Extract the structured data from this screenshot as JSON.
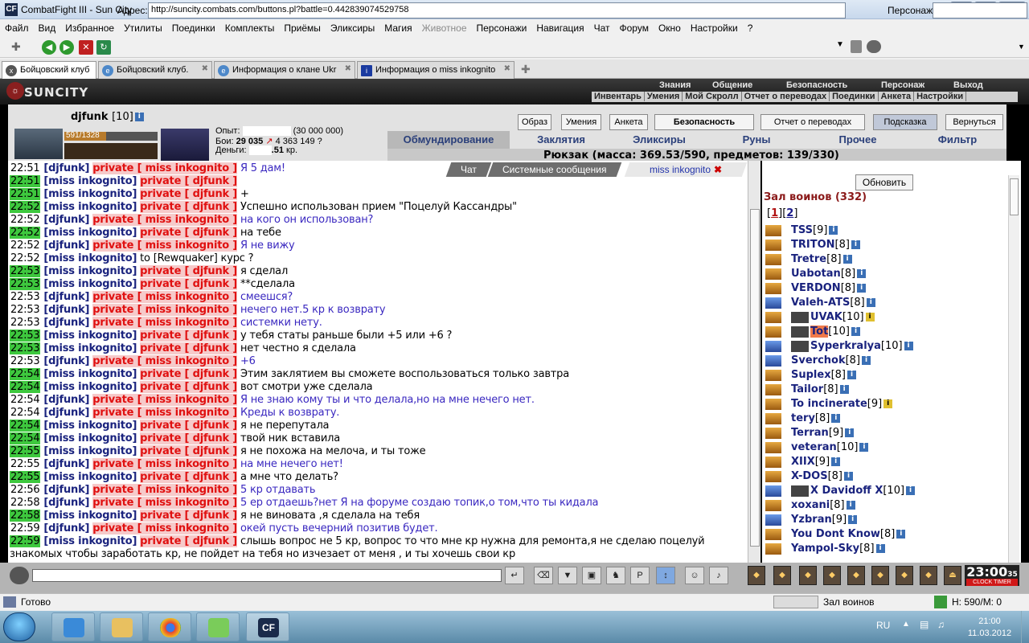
{
  "window": {
    "title": "CombatFight III - Sun City",
    "app_icon": "CF",
    "buttons": [
      "_",
      "▫",
      "X"
    ]
  },
  "menu": [
    {
      "label": "Файл"
    },
    {
      "label": "Вид"
    },
    {
      "label": "Избранное"
    },
    {
      "label": "Утилиты"
    },
    {
      "label": "Поединки"
    },
    {
      "label": "Комплекты"
    },
    {
      "label": "Приёмы"
    },
    {
      "label": "Эликсиры"
    },
    {
      "label": "Магия"
    },
    {
      "label": "Животное",
      "dim": true
    },
    {
      "label": "Персонажи"
    },
    {
      "label": "Навигация"
    },
    {
      "label": "Чат"
    },
    {
      "label": "Форум"
    },
    {
      "label": "Окно"
    },
    {
      "label": "Настройки"
    },
    {
      "label": "?"
    }
  ],
  "address": {
    "label": "Адрес:",
    "url": "http://suncity.combats.com/buttons.pl?battle=0.442839074529758",
    "persona_label": "Персонаж:"
  },
  "tabs": [
    {
      "label": "Бойцовский клуб",
      "icon": "x",
      "active": true
    },
    {
      "label": "Бойцовский клуб.",
      "icon": "e"
    },
    {
      "label": "Информация о клане Ukr",
      "icon": "e"
    },
    {
      "label": "Информация о miss inkognito",
      "icon": "i"
    }
  ],
  "game": {
    "logo": "SUNCITY",
    "nav_top": [
      "Знания",
      "Общение",
      "Безопасность",
      "Персонаж",
      "Выход"
    ],
    "nav_sub": [
      "Инвентарь",
      "Умения",
      "Мой Скролл",
      "Отчет о переводах",
      "Поединки",
      "Анкета",
      "Настройки"
    ],
    "char": {
      "name": "djfunk",
      "level": "[10]",
      "hp": "591/1328",
      "hp_fraction": 0.445
    },
    "stats": [
      {
        "label": "Опыт:",
        "value": "(30 000 000)"
      },
      {
        "label": "Бои:",
        "value": "29 035",
        "extra": "4 363",
        "extra2": "149",
        "q": "?"
      },
      {
        "label": "Деньги:",
        "value": ".51",
        "unit": "кр."
      }
    ],
    "top_buttons": [
      "Образ",
      "Умения",
      "Анкета",
      "Безопасность",
      "Отчет о переводах",
      "Подсказка",
      "Вернуться"
    ],
    "tabs": [
      "Обмундирование",
      "Заклятия",
      "Эликсиры",
      "Руны",
      "Прочее",
      "Фильтр"
    ],
    "backpack": "Рюкзак (масса: 369.53/590, предметов: 139/330)"
  },
  "chat": {
    "tabs": [
      "Чат",
      "Системные сообщения",
      "miss inkognito"
    ],
    "private_label": "private",
    "lines": [
      {
        "time": "22:51",
        "g": false,
        "from": "[djfunk]",
        "to": "[ miss inkognito ]",
        "msg": "Я 5 дам!",
        "blue": true
      },
      {
        "time": "22:51",
        "g": true,
        "from": "[miss inkognito]",
        "to": "[ djfunk ]",
        "msg": ""
      },
      {
        "time": "22:51",
        "g": true,
        "from": "[miss inkognito]",
        "to": "[ djfunk ]",
        "msg": "+"
      },
      {
        "time": "22:52",
        "g": true,
        "from": "[miss inkognito]",
        "to": "[ djfunk ]",
        "msg": "Успешно использован прием \"Поцелуй Кассандры\""
      },
      {
        "time": "22:52",
        "g": false,
        "from": "[djfunk]",
        "to": "[ miss inkognito ]",
        "msg": "на кого он использован?",
        "blue": true
      },
      {
        "time": "22:52",
        "g": true,
        "from": "[miss inkognito]",
        "to": "[ djfunk ]",
        "msg": "на тебе"
      },
      {
        "time": "22:52",
        "g": false,
        "from": "[djfunk]",
        "to": "[ miss inkognito ]",
        "msg": "Я не вижу",
        "blue": true
      },
      {
        "time": "22:52",
        "g": false,
        "from": "[miss inkognito]",
        "to": "",
        "msg": "to [Rewquaker] курс ?",
        "public": true
      },
      {
        "time": "22:53",
        "g": true,
        "from": "[miss inkognito]",
        "to": "[ djfunk ]",
        "msg": "я сделал"
      },
      {
        "time": "22:53",
        "g": true,
        "from": "[miss inkognito]",
        "to": "[ djfunk ]",
        "msg": "**сделала"
      },
      {
        "time": "22:53",
        "g": false,
        "from": "[djfunk]",
        "to": "[ miss inkognito ]",
        "msg": "смеешся?",
        "blue": true
      },
      {
        "time": "22:53",
        "g": false,
        "from": "[djfunk]",
        "to": "[ miss inkognito ]",
        "msg": "нечего нет.5 кр к возврату",
        "blue": true
      },
      {
        "time": "22:53",
        "g": false,
        "from": "[djfunk]",
        "to": "[ miss inkognito ]",
        "msg": "системки нету.",
        "blue": true
      },
      {
        "time": "22:53",
        "g": true,
        "from": "[miss inkognito]",
        "to": "[ djfunk ]",
        "msg": "у тебя статы раньше были +5 или +6 ?"
      },
      {
        "time": "22:53",
        "g": true,
        "from": "[miss inkognito]",
        "to": "[ djfunk ]",
        "msg": "нет честно я сделала"
      },
      {
        "time": "22:53",
        "g": false,
        "from": "[djfunk]",
        "to": "[ miss inkognito ]",
        "msg": "+6",
        "blue": true
      },
      {
        "time": "22:54",
        "g": true,
        "from": "[miss inkognito]",
        "to": "[ djfunk ]",
        "msg": "Этим заклятием вы сможете воспользоваться только завтра"
      },
      {
        "time": "22:54",
        "g": true,
        "from": "[miss inkognito]",
        "to": "[ djfunk ]",
        "msg": "вот смотри уже сделала"
      },
      {
        "time": "22:54",
        "g": false,
        "from": "[djfunk]",
        "to": "[ miss inkognito ]",
        "msg": "Я не знаю кому ты и что делала,но на мне нечего нет.",
        "blue": true
      },
      {
        "time": "22:54",
        "g": false,
        "from": "[djfunk]",
        "to": "[ miss inkognito ]",
        "msg": "Креды к возврату.",
        "blue": true
      },
      {
        "time": "22:54",
        "g": true,
        "from": "[miss inkognito]",
        "to": "[ djfunk ]",
        "msg": "я не перепутала"
      },
      {
        "time": "22:54",
        "g": true,
        "from": "[miss inkognito]",
        "to": "[ djfunk ]",
        "msg": "твой ник вставила"
      },
      {
        "time": "22:55",
        "g": true,
        "from": "[miss inkognito]",
        "to": "[ djfunk ]",
        "msg": "я не похожа на мелоча, и ты тоже"
      },
      {
        "time": "22:55",
        "g": false,
        "from": "[djfunk]",
        "to": "[ miss inkognito ]",
        "msg": "на мне нечего нет!",
        "blue": true
      },
      {
        "time": "22:55",
        "g": true,
        "from": "[miss inkognito]",
        "to": "[ djfunk ]",
        "msg": "а мне что делать?"
      },
      {
        "time": "22:56",
        "g": false,
        "from": "[djfunk]",
        "to": "[ miss inkognito ]",
        "msg": "5 кр отдавать",
        "blue": true
      },
      {
        "time": "22:58",
        "g": false,
        "from": "[djfunk]",
        "to": "[ miss inkognito ]",
        "msg": "5 ер отдаешь?нет Я на форуме создаю топик,о том,что ты кидала",
        "blue": true
      },
      {
        "time": "22:58",
        "g": true,
        "from": "[miss inkognito]",
        "to": "[ djfunk ]",
        "msg": "я не виновата ,я сделала на тебя"
      },
      {
        "time": "22:59",
        "g": false,
        "from": "[djfunk]",
        "to": "[ miss inkognito ]",
        "msg": "окей пусть вечерний позитив будет.",
        "blue": true
      },
      {
        "time": "22:59",
        "g": true,
        "from": "[miss inkognito]",
        "to": "[ djfunk ]",
        "msg": "слышь вопрос не 5 кр, вопрос то что мне кр нужна для ремонта,я не сделаю поцелуй"
      }
    ],
    "wrap_line": "знакомых чтобы заработать кр, не пойдет на тебя но изчезает от меня , и ты хочешь свои кр"
  },
  "roster": {
    "refresh": "Обновить",
    "title": "Зал воинов (332)",
    "pages": [
      "1",
      "2"
    ],
    "players": [
      {
        "name": "TSS",
        "lvl": "[9]"
      },
      {
        "name": "TRITON",
        "lvl": "[8]"
      },
      {
        "name": "Tretre",
        "lvl": "[8]"
      },
      {
        "name": "Uabotan",
        "lvl": "[8]"
      },
      {
        "name": "VERDON",
        "lvl": "[8]"
      },
      {
        "name": "Valeh-ATS",
        "lvl": "[8]",
        "blue": true
      },
      {
        "name": "UVAK",
        "lvl": "[10]",
        "clan": true,
        "yellow": true
      },
      {
        "name": "Tot",
        "lvl": "[10]",
        "clan": true,
        "hl": true
      },
      {
        "name": "Syperkralya",
        "lvl": "[10]",
        "clan": true,
        "blue": true
      },
      {
        "name": "Sverchok",
        "lvl": "[8]",
        "blue": true
      },
      {
        "name": "Suplex",
        "lvl": "[8]"
      },
      {
        "name": "Tailor",
        "lvl": "[8]"
      },
      {
        "name": "To incinerate",
        "lvl": "[9]",
        "yellow": true
      },
      {
        "name": "tery",
        "lvl": "[8]"
      },
      {
        "name": "Terran",
        "lvl": "[9]"
      },
      {
        "name": "veteran",
        "lvl": "[10]"
      },
      {
        "name": "XIIX",
        "lvl": "[9]"
      },
      {
        "name": "X-DOS",
        "lvl": "[8]"
      },
      {
        "name": "X Davidoff X",
        "lvl": "[10]",
        "clan": true,
        "blue": true
      },
      {
        "name": "xoxani",
        "lvl": "[8]"
      },
      {
        "name": "Yzbran",
        "lvl": "[9]",
        "blue": true
      },
      {
        "name": "You Dont Know",
        "lvl": "[8]"
      },
      {
        "name": "Yampol-Sky",
        "lvl": "[8]"
      }
    ]
  },
  "clock": {
    "time": "23:00",
    "sec": "35",
    "label": "CLOCK  TIMER"
  },
  "status": {
    "text": "Готово",
    "zone": "Зал воинов",
    "hm": "Н: 590/М: 0"
  },
  "tray": {
    "lang": "RU",
    "time": "21:00",
    "date": "11.03.2012"
  },
  "colors": {
    "accent": "#1a237e",
    "private": "#e01010",
    "time_green": "#3ec83e"
  }
}
